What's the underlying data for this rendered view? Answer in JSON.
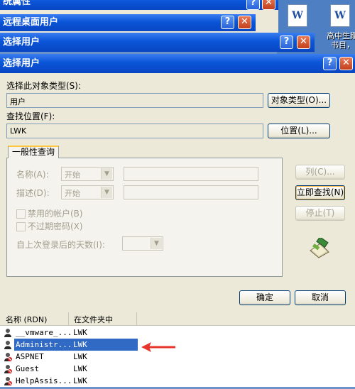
{
  "desktop": {
    "icon1_label": "",
    "icon2_label": "高中生期",
    "icon2_label2": "书目，"
  },
  "back_windows": [
    {
      "title": "统属性"
    },
    {
      "title": "远程桌面用户"
    },
    {
      "title": "选择用户"
    }
  ],
  "titlebar_buttons": {
    "help": "?",
    "close": "✕"
  },
  "dialog": {
    "title": "选择用户",
    "object_type_label": "选择此对象类型(S):",
    "object_type_value": "用户",
    "object_type_button": "对象类型(O)...",
    "location_label": "查找位置(F):",
    "location_value": "LWK",
    "location_button": "位置(L)...",
    "tab_general": "一般性查询",
    "name_label": "名称(A):",
    "name_combo": "开始",
    "desc_label": "描述(D):",
    "desc_combo": "开始",
    "disabled_accounts": "禁用的帐户(B)",
    "non_expiring": "不过期密码(X)",
    "days_since_login": "自上次登录后的天数(I):",
    "columns_button": "列(C)...",
    "find_now_button": "立即查找(N)",
    "stop_button": "停止(T)",
    "ok_button": "确定",
    "cancel_button": "取消"
  },
  "results": {
    "col_name": "名称 (RDN)",
    "col_folder": "在文件夹中",
    "rows": [
      {
        "name": "__vmware_...",
        "folder": "LWK"
      },
      {
        "name": "Administr...",
        "folder": "LWK"
      },
      {
        "name": "ASPNET",
        "folder": "LWK"
      },
      {
        "name": "Guest",
        "folder": "LWK"
      },
      {
        "name": "HelpAssis...",
        "folder": "LWK"
      }
    ],
    "selected_index": 1
  },
  "colors": {
    "titlebar": "#0a55d8",
    "dialog_bg": "#ece9d8",
    "selection": "#316ac5",
    "arrow": "#e8352b"
  }
}
